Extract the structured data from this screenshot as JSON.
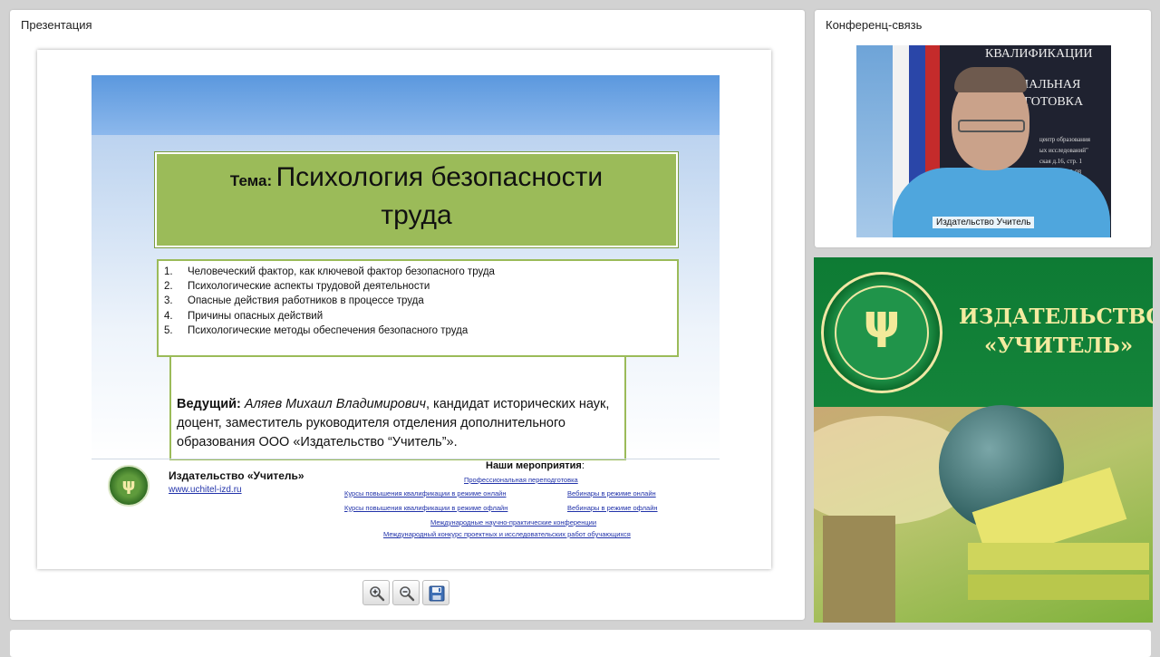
{
  "presentation_panel": {
    "title": "Презентация",
    "slide": {
      "topic_label": "Тема:",
      "topic_line1": "Психология безопасности",
      "topic_line2": "труда",
      "items": [
        {
          "num": "1.",
          "text": "Человеческий фактор, как ключевой фактор безопасного труда"
        },
        {
          "num": "2.",
          "text": "Психологические аспекты трудовой деятельности"
        },
        {
          "num": "3.",
          "text": "Опасные действия работников в процессе труда"
        },
        {
          "num": "4.",
          "text": "Причины опасных действий"
        },
        {
          "num": "5.",
          "text": "Психологические методы обеспечения безопасного труда"
        }
      ],
      "host_label": "Ведущий:",
      "host_name": "Аляев Михаил Владимирович",
      "host_details": ", кандидат исторических наук, доцент, заместитель руководителя отделения дополнительного образования ООО «Издательство “Учитель”».",
      "footer_name": "Издательство «Учитель»",
      "footer_url": "www.uchitel-izd.ru",
      "events_title": "Наши мероприятия",
      "events_title_suffix": ":",
      "events": {
        "retraining": "Профессиональная переподготовка",
        "courses_online": "Курсы повышения квалификации в режиме онлайн",
        "webinars_online": "Вебинары в режиме онлайн",
        "courses_offline": "Курсы повышения квалификации в режиме офлайн",
        "webinars_offline": "Вебинары в режиме офлайн",
        "conferences": "Международные научно-практические конференции",
        "contest": "Международный конкурс проектных и исследовательских работ обучающихся"
      }
    },
    "toolbar": {
      "zoom_in_icon": "zoom-in-icon",
      "zoom_out_icon": "zoom-out-icon",
      "save_icon": "save-icon"
    }
  },
  "conference_panel": {
    "title": "Конференц-связь",
    "video_caption": "Издательство Учитель",
    "background_text": {
      "line1": "КВАЛИФИКАЦИИ",
      "line2": "НАЛЬНАЯ",
      "line3": "ГОТОВКА",
      "line4": "центр образования",
      "line5": "ых исследований\"",
      "line6": "ская д.16, стр. 1",
      "line7": "(499) 753-18-08"
    }
  },
  "ad_banner": {
    "line1": "ИЗДАТЕЛЬСТВО",
    "line2": "«УЧИТЕЛЬ»"
  },
  "colors": {
    "slide_green": "#9bbb59",
    "slide_blue": "#5b98de",
    "ad_green": "#0e7b34",
    "ad_text": "#f4eba0",
    "link_blue": "#2233aa"
  }
}
